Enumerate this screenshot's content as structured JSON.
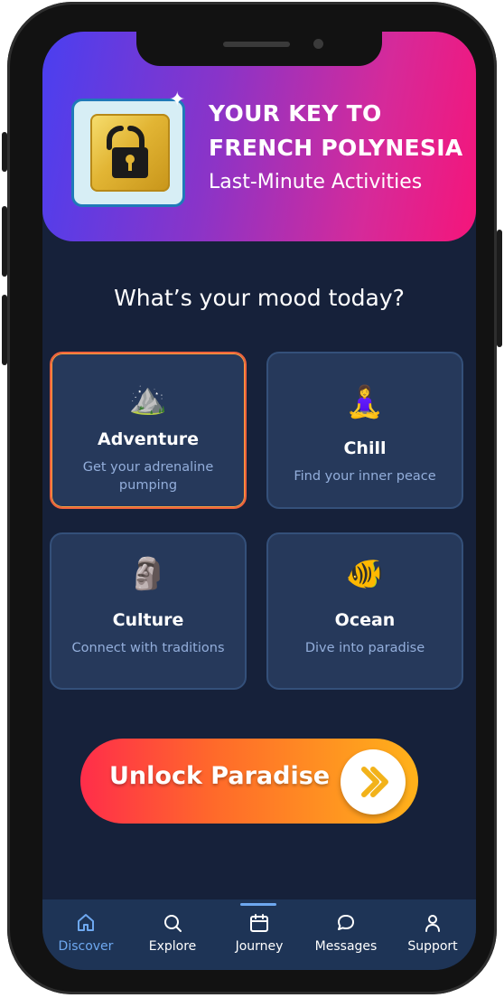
{
  "header": {
    "title_line1": "YOUR KEY TO",
    "title_line2": "FRENCH POLYNESIA",
    "subtitle": "Last-Minute Activities",
    "logo_icon": "unlock-padlock-icon"
  },
  "mood": {
    "title": "What’s your mood today?",
    "cards": [
      {
        "emoji": "⛰️",
        "title": "Adventure",
        "desc": "Get your adrenaline pumping",
        "selected": true
      },
      {
        "emoji": "🧘‍♀️",
        "title": "Chill",
        "desc": "Find your inner peace",
        "selected": false
      },
      {
        "emoji": "🗿",
        "title": "Culture",
        "desc": "Connect with traditions",
        "selected": false
      },
      {
        "emoji": "🐠",
        "title": "Ocean",
        "desc": "Dive into paradise",
        "selected": false
      }
    ]
  },
  "cta": {
    "label": "Unlock Paradise",
    "icon": "double-chevron-right-icon"
  },
  "tabbar": {
    "items": [
      {
        "label": "Discover",
        "icon": "home-icon",
        "active": true
      },
      {
        "label": "Explore",
        "icon": "search-icon",
        "active": false
      },
      {
        "label": "Journey",
        "icon": "calendar-icon",
        "active": false
      },
      {
        "label": "Messages",
        "icon": "chat-bubble-icon",
        "active": false
      },
      {
        "label": "Support",
        "icon": "user-icon",
        "active": false
      }
    ]
  },
  "colors": {
    "background": "#16213a",
    "card": "#26395b",
    "accent_blue": "#6ea8f0",
    "cta_start": "#ff2d4a",
    "cta_end": "#ffb21a",
    "header_start": "#4a3ff0",
    "header_end": "#f5157a"
  }
}
